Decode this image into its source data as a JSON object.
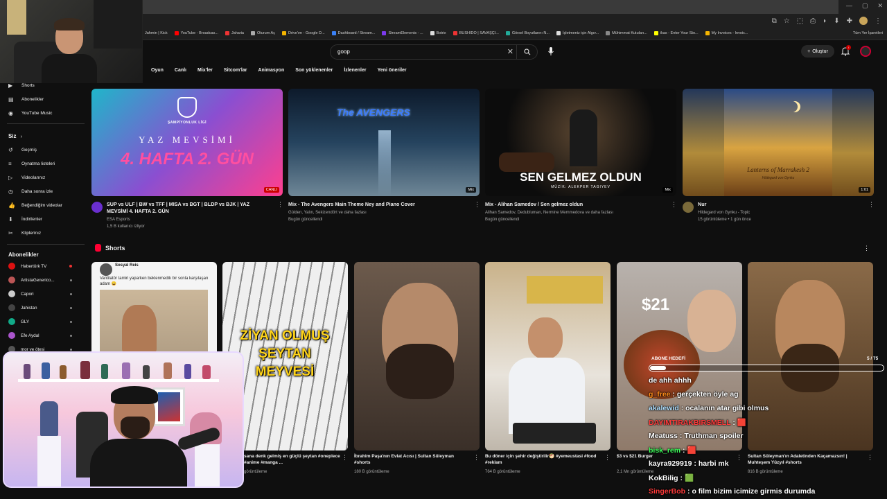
{
  "browser": {
    "bookmarks": [
      {
        "label": "Jahmin | Kick",
        "color": "#53fc18"
      },
      {
        "label": "YouTube - Broadcas...",
        "color": "#ff0000"
      },
      {
        "label": "Jaharia",
        "color": "#e33"
      },
      {
        "label": "Oturum Aç",
        "color": "#aaa"
      },
      {
        "label": "Drive'ım - Google D...",
        "color": "#f4b400"
      },
      {
        "label": "Dashboard / Stream...",
        "color": "#3b82f6"
      },
      {
        "label": "StreamElements - ...",
        "color": "#7c3aed"
      },
      {
        "label": "Botrix",
        "color": "#ddd"
      },
      {
        "label": "BUSHIDO | SAVAŞÇI...",
        "color": "#e33"
      },
      {
        "label": "Görsel Boyutlarını N...",
        "color": "#2a9"
      },
      {
        "label": "İşletmeniz için Algıv...",
        "color": "#ddd"
      },
      {
        "label": "Mühimmat Kutuları...",
        "color": "#888"
      },
      {
        "label": "ikas - Enter Your Sto...",
        "color": "#ff0"
      },
      {
        "label": "My Invoices - Invoic...",
        "color": "#f4b400"
      }
    ],
    "bookmarks_right": "Tüm Yer İşaretleri"
  },
  "header": {
    "search_value": "goop",
    "create_label": "Oluştur",
    "notif_count": "!"
  },
  "chips": [
    "Oyun",
    "Canlı",
    "Mix'ler",
    "Sitcom'lar",
    "Animasyon",
    "Son yüklenenler",
    "İzlenenler",
    "Yeni öneriler"
  ],
  "sidebar": {
    "nav": [
      {
        "label": "Shorts",
        "icon": "shorts-icon"
      },
      {
        "label": "Abonelikler",
        "icon": "subscriptions-icon"
      },
      {
        "label": "YouTube Music",
        "icon": "music-icon"
      }
    ],
    "you_heading": "Siz",
    "you_items": [
      {
        "label": "Geçmiş",
        "icon": "history-icon"
      },
      {
        "label": "Oynatma listeleri",
        "icon": "playlist-icon"
      },
      {
        "label": "Videolarınız",
        "icon": "video-icon"
      },
      {
        "label": "Daha sonra izle",
        "icon": "clock-icon"
      },
      {
        "label": "Beğendiğim videolar",
        "icon": "like-icon"
      },
      {
        "label": "İndirilenler",
        "icon": "download-icon"
      },
      {
        "label": "Kliplerinız",
        "icon": "scissors-icon"
      }
    ],
    "subs_heading": "Abonelikler",
    "subs": [
      {
        "label": "Habertürk TV",
        "color": "#d11",
        "live": true
      },
      {
        "label": "ArtistaGenerico...",
        "color": "#b55",
        "live": false
      },
      {
        "label": "Capori",
        "color": "#ccc",
        "live": false
      },
      {
        "label": "Jahistan",
        "color": "#444",
        "live": false
      },
      {
        "label": "GLY",
        "color": "#1a8",
        "live": false
      },
      {
        "label": "Efe Aydal",
        "color": "#a5c",
        "live": false
      },
      {
        "label": "mor ve ötesi",
        "color": "#555",
        "live": false
      }
    ]
  },
  "videos": [
    {
      "title": "SUP vs ULF | BW vs TFF | MISA vs BGT | BLDP vs BJK | YAZ MEVSİMİ 4. HAFTA 2. GÜN",
      "channel": "ESA Esports",
      "meta": "1,5 B kullanıcı izliyor",
      "badge": "CANLI",
      "thumb_text": "4. HAFTA 2. GÜN",
      "thumb_sub": "YAZ MEVSİMİ",
      "thumb_top": "ŞAMPİYONLUK LİGİ"
    },
    {
      "title": "Mix - The Avengers Main Theme Ney and Piano Cover",
      "channel": "Gülden, Yalın, Sekizendört ve daha fazlası",
      "meta": "Bugün güncellendi",
      "badge": "Mix",
      "thumb_text": "The AVENGERS"
    },
    {
      "title": "Mix - Alihan Samedov / Sen gelmez oldun",
      "channel": "Alihan Samedov, Dedubluman, Nermine Memmedova ve daha fazlası",
      "meta": "Bugün güncellendi",
      "badge": "Mix",
      "thumb_text": "SEN GELMEZ OLDUN",
      "thumb_sub": "MÜZİK: ALEKPER TAGIYEV"
    },
    {
      "title": "Nur",
      "channel": "Hildegard von Gynku - Topic",
      "meta": "15 görüntüleme • 1 gün önce",
      "badge": "1:01",
      "thumb_text": "Lanterns of Marrakesh 2",
      "thumb_sub": "Hildegard von Gynku"
    }
  ],
  "shorts_heading": "Shorts",
  "shorts": [
    {
      "title": "",
      "meta": "",
      "thumb_text": "Vantilatör tamiri yaparken beklenmedik bir sonla karşılaşan adam 😄",
      "thumb_user": "Sosyal Reis"
    },
    {
      "title": "sana denk gelmiş en güçlü şeytan #oneplece #anime #manga ...",
      "meta": "görüntüleme",
      "thumb_text": "ZİYAN OLMUŞ ŞEYTAN MEYVESİ"
    },
    {
      "title": "İbrahim Paşa'nın Evlat Acısı | Sultan Süleyman #shorts",
      "meta": "180 B görüntüleme"
    },
    {
      "title": "Bu döner için şehir değiştirilir🥙 #yemeustasi #food #reklam",
      "meta": "764 B görüntüleme"
    },
    {
      "title": "$3 vs $21 Burger",
      "meta": "2,1 Mn görüntüleme",
      "thumb_text": "$21"
    },
    {
      "title": "Sultan Süleyman'ın Adaletinden Kaçamazsın! | Muhteşem Yüzyıl #shorts",
      "meta": "816 B görüntüleme"
    }
  ],
  "overlay": {
    "goal_label": "ABONE HEDEFİ",
    "goal_count": "5 / 75",
    "goal_fraction": 0.067,
    "chat": [
      {
        "user": "",
        "text": "de ahh ahhh",
        "color": "#ffffff"
      },
      {
        "user": "g_free",
        "text": "gerçekten öyle ag",
        "color": "#ff8c1a"
      },
      {
        "user": "akalewid",
        "text": "ocalanın atar gibi olmus",
        "color": "#b0e0ff"
      },
      {
        "user": "DAYIMTIRAKBIRSMELL",
        "text": "🟥",
        "color": "#ff3b3b"
      },
      {
        "user": "Meatuss",
        "text": "Truthman spoiler",
        "color": "#ffffff"
      },
      {
        "user": "bisk_rem",
        "text": "🟥",
        "color": "#3bff5a"
      },
      {
        "user": "kayra929919",
        "text": "harbi mk",
        "color": "#ffffff"
      },
      {
        "user": "KokBilig",
        "text": "🟩",
        "color": "#ffffff"
      },
      {
        "user": "SingerBob",
        "text": "o film bizim icimize girmis durumda",
        "color": "#ff3b3b"
      }
    ]
  }
}
